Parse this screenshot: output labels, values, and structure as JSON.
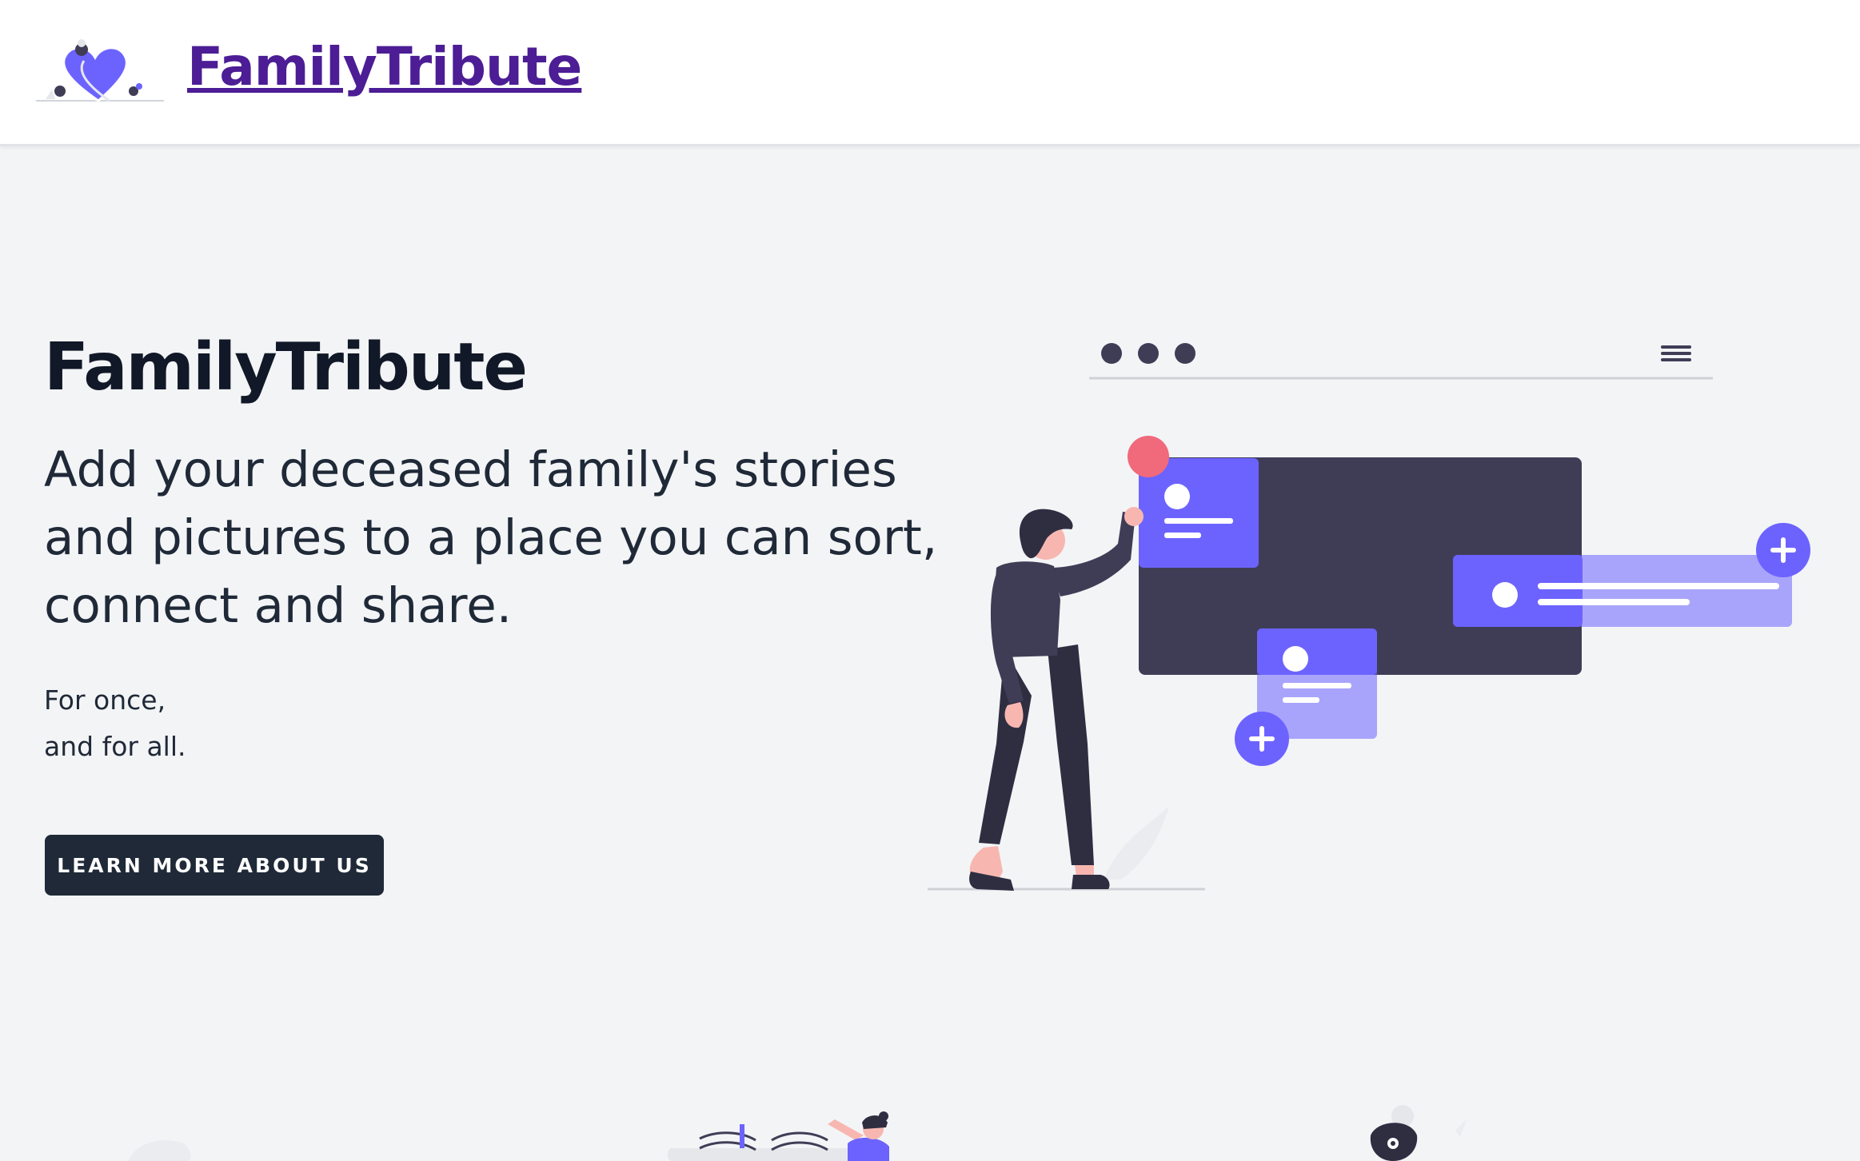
{
  "header": {
    "brand": "FamilyTribute",
    "logo_icon": "heart-icon"
  },
  "hero": {
    "title": "FamilyTribute",
    "subtitle": "Add your deceased family's stories and pictures to a place you can sort, connect and share.",
    "tagline_line1": "For once,",
    "tagline_line2": "and for all.",
    "cta_label": "LEARN MORE ABOUT US",
    "illustration_icon": "person-building-profile-cards-illustration"
  },
  "colors": {
    "brand": "#4c1d95",
    "accent": "#6c63ff",
    "dark": "#3f3d56",
    "button": "#1f2937",
    "background": "#f3f4f6",
    "pink": "#f06a7c"
  }
}
